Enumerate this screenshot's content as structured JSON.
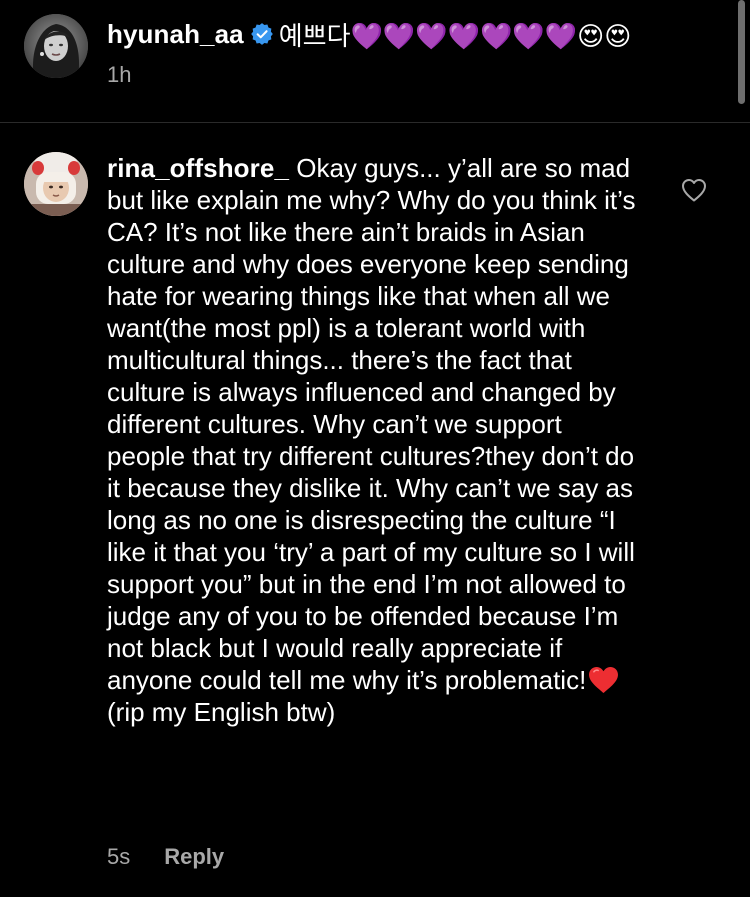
{
  "post_caption": {
    "username": "hyunah_aa",
    "text": "예쁘다💜💜💜💜💜💜💜😍😍",
    "timestamp": "1h",
    "verified_icon": "verified-badge-icon",
    "verified_color": "#3897f0"
  },
  "comment": {
    "username": "rina_offshore_",
    "text_before_emoji": "Okay guys... y’all are so mad but like explain me why? Why do you think it’s CA? It’s not like there ain’t braids in Asian culture and why does everyone keep sending hate for wearing things like that when all we want(the most ppl) is a tolerant world with multicultural things... there’s the fact that culture is always influenced and changed by different cultures. Why can’t we support people that try different cultures?they don’t do it because they dislike it. Why can’t we say as long as no one is disrespecting the culture “I like it that you ‘try’ a part of my culture so I will support you” but in the end I’m not allowed to judge any of you to be offended because I’m not black but I would really appreciate if anyone could tell me why it’s problematic!",
    "emoji": "red-heart-icon",
    "text_after_emoji": " (rip my English btw)",
    "timestamp": "5s",
    "reply_label": "Reply",
    "like_icon": "heart-outline-icon"
  },
  "colors": {
    "background": "#000000",
    "secondary_text": "#a8a8a8",
    "heart_red": "#ed2e32"
  }
}
